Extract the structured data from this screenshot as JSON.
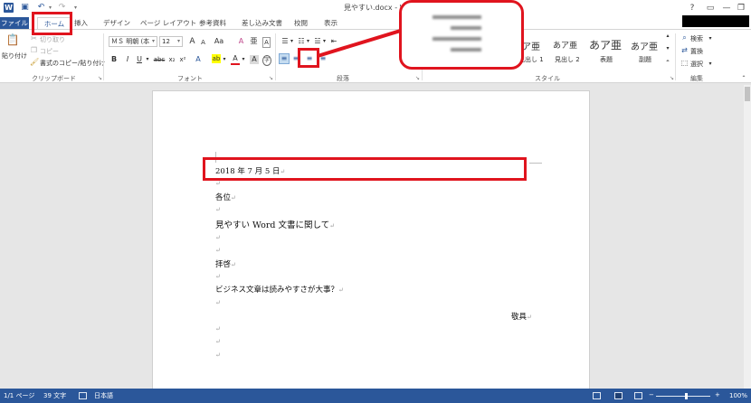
{
  "titlebar": {
    "title": "見やすい.docx - W",
    "icons": [
      "word-logo",
      "save-icon",
      "undo-icon",
      "redo-icon",
      "customize-icon"
    ],
    "buttons": {
      "help": "?",
      "ribbon_options": "▭",
      "minimize": "—",
      "maximize": "❐",
      "close": "✕"
    }
  },
  "tabs": [
    "ファイル",
    "ホーム",
    "挿入",
    "デザイン",
    "ページ レイアウト",
    "参考資料",
    "差し込み文書",
    "校閲",
    "表示"
  ],
  "ribbon": {
    "clipboard": {
      "label": "クリップボード",
      "paste": "貼り付け",
      "cut": "切り取り",
      "copy": "コピー",
      "format_painter": "書式のコピー/貼り付け"
    },
    "font": {
      "label": "フォント",
      "font_name": "ＭＳ 明朝 (本",
      "font_size": "12",
      "bold": "B",
      "italic": "I",
      "underline": "U",
      "strike": "abc",
      "subscript": "x₂",
      "superscript": "x²",
      "grow": "A",
      "shrink": "A",
      "case": "Aa",
      "clear": "A",
      "phonetic": "亜",
      "highlight": "ab",
      "font_color": "A",
      "shade": "A",
      "encircle": "字"
    },
    "paragraph": {
      "label": "段落",
      "align_left": "≡",
      "align_center": "≡",
      "align_right": "≡",
      "justify": "≡"
    },
    "styles": {
      "label": "スタイル",
      "items": [
        {
          "preview": "あア亜",
          "name": "見出し 1"
        },
        {
          "preview": "あア亜",
          "name": "見出し 2"
        },
        {
          "preview": "あア亜",
          "name": "表題"
        },
        {
          "preview": "あア亜",
          "name": "副題"
        }
      ]
    },
    "editing": {
      "label": "編集",
      "find": "検索",
      "replace": "置換",
      "select": "選択"
    }
  },
  "document": {
    "lines": [
      {
        "text": "2018 年 7 月 5 日"
      },
      {
        "text": "各位"
      },
      {
        "text": "見やすい Word 文書に関して"
      },
      {
        "text": "拝啓"
      },
      {
        "text": "ビジネス文章は読みやすさが大事？"
      },
      {
        "text": "敬具"
      }
    ],
    "paragraph_mark": "↵"
  },
  "statusbar": {
    "page": "1/1 ページ",
    "words": "39 文字",
    "language": "日本語",
    "zoom": "100%",
    "zoom_minus": "−",
    "zoom_plus": "+"
  },
  "colors": {
    "accent": "#2b579a",
    "annotation": "#e0141e",
    "highlight_yellow": "#ffff00",
    "font_red": "#e0141e"
  }
}
